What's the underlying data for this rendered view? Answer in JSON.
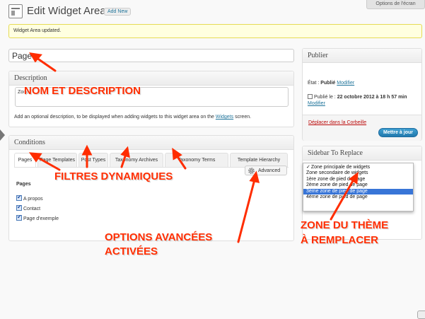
{
  "header": {
    "title": "Edit Widget Area",
    "add_new": "Add New",
    "screen_options": "Options de l'écran"
  },
  "notice": "Widget Area updated.",
  "title_input": "Page",
  "description": {
    "heading": "Description",
    "textarea": "Zone",
    "help_prefix": "Add an optional description, to be displayed when adding widgets to this widget area on the ",
    "help_link": "Widgets",
    "help_suffix": " screen."
  },
  "conditions": {
    "heading": "Conditions",
    "tabs": [
      "Pages",
      "Page Templates",
      "Post Types",
      "Taxonomy Archives",
      "Taxonomy Terms",
      "Template Hierarchy"
    ],
    "advanced": "Advanced",
    "pages_heading": "Pages",
    "pages": [
      "A propos",
      "Contact",
      "Page d'exemple"
    ]
  },
  "publish": {
    "heading": "Publier",
    "status_label": "État : ",
    "status_value": "Publié",
    "modify": "Modifier",
    "date_label": "Publié le : ",
    "date_value": "22 octobre 2012 à 18 h 57 min",
    "modify2": "Modifier",
    "trash": "Déplacer dans la Corbeille",
    "update": "Mettre à jour"
  },
  "sidebar_replace": {
    "heading": "Sidebar To Replace",
    "options": [
      "Zone principale de widgets",
      "Zone secondaire de widgets",
      "1ère zone de pied de page",
      "2ème zone de pied de page",
      "3ème zone de pied de page",
      "4ème zone de pied de page"
    ],
    "selected_index": 0,
    "highlighted_index": 4
  },
  "annotations": {
    "nom": "NOM ET DESCRIPTION",
    "filtres": "FILTRES DYNAMIQUES",
    "options_line1": "OPTIONS AVANCÉES",
    "options_line2": "ACTIVÉES",
    "zone_line1": "ZONE DU THÈME",
    "zone_line2": "À REMPLACER"
  },
  "colors": {
    "annotation": "#ff2d00",
    "link": "#21759b",
    "notice_bg": "#ffffe0",
    "highlight": "#3875d7"
  }
}
